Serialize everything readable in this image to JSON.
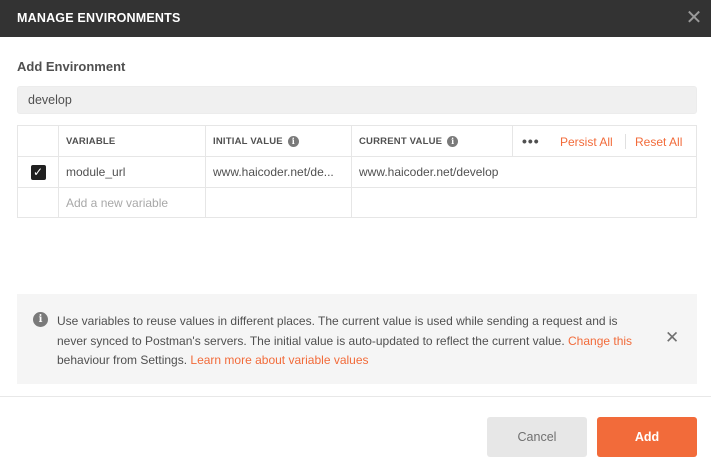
{
  "dialog": {
    "title": "MANAGE ENVIRONMENTS",
    "close_glyph": "✕"
  },
  "form": {
    "section_label": "Add Environment",
    "env_name_value": "develop"
  },
  "table": {
    "headers": {
      "variable": "VARIABLE",
      "initial_value": "INITIAL VALUE",
      "current_value": "CURRENT VALUE",
      "more_glyph": "•••",
      "persist_all": "Persist All",
      "reset_all": "Reset All"
    },
    "rows": [
      {
        "enabled": true,
        "variable": "module_url",
        "initial_value": "www.haicoder.net/de...",
        "current_value": "www.haicoder.net/develop"
      }
    ],
    "new_row_placeholder": "Add a new variable"
  },
  "notice": {
    "text_1": "Use variables to reuse values in different places. The current value is used while sending a request and is never synced to Postman's servers. The initial value is auto-updated to reflect the current value. ",
    "link_change": "Change this",
    "text_2": " behaviour from Settings. ",
    "link_learn": "Learn more about variable values",
    "close_glyph": "✕"
  },
  "buttons": {
    "cancel": "Cancel",
    "add": "Add"
  },
  "icons": {
    "info_glyph": "i",
    "check_glyph": "✓"
  },
  "colors": {
    "accent": "#f26b3a",
    "titlebar": "#333333"
  }
}
